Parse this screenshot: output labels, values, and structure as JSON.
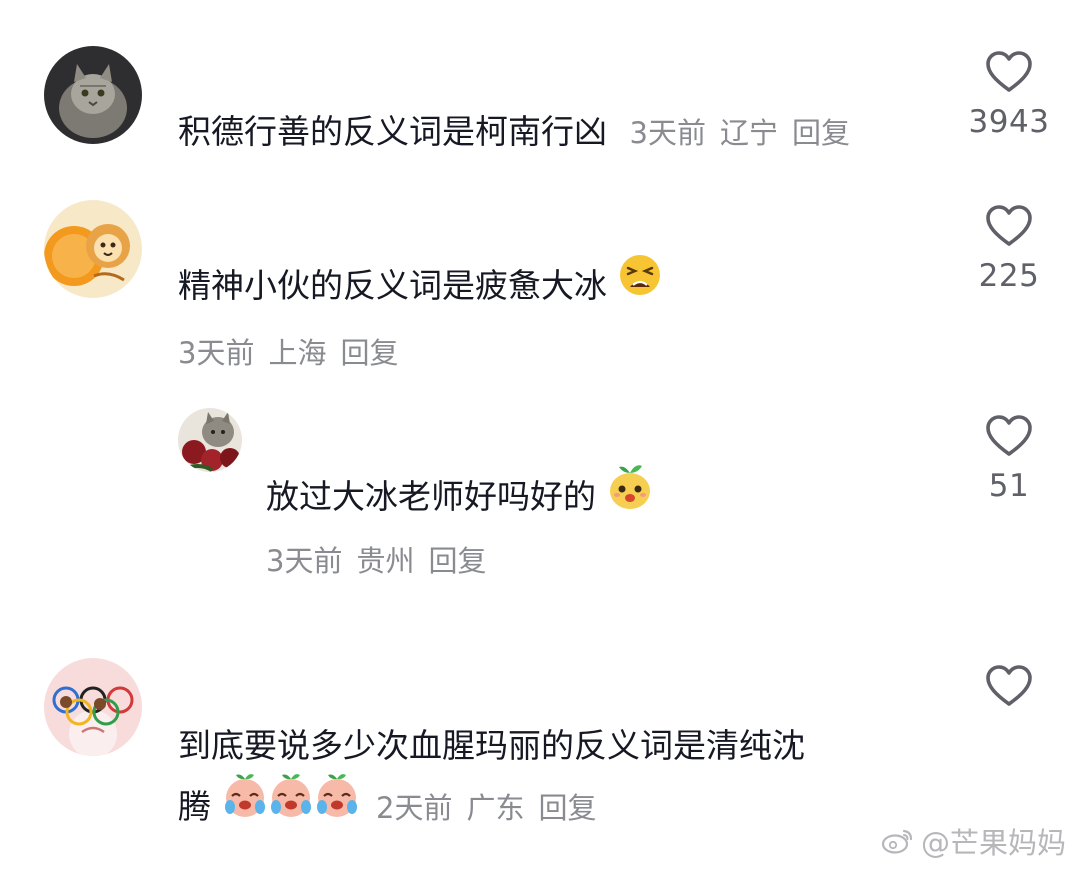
{
  "comments": [
    {
      "text": "积德行善的反义词是柯南行凶",
      "time": "3天前",
      "location": "辽宁",
      "reply_label": "回复",
      "likes": "3943",
      "avatar_icon": "cat-avatar-icon"
    },
    {
      "text": "精神小伙的反义词是疲惫大冰",
      "emoji_icon": "tired-face-emoji-icon",
      "time": "3天前",
      "location": "上海",
      "reply_label": "回复",
      "likes": "225",
      "avatar_icon": "lion-cartoon-avatar-icon"
    },
    {
      "text": "放过大冰老师好吗好的",
      "emoji_icon": "sprout-face-emoji-icon",
      "time": "3天前",
      "location": "贵州",
      "reply_label": "回复",
      "likes": "51",
      "avatar_icon": "cat-roses-avatar-icon"
    },
    {
      "text_line1": "到底要说多少次血腥玛丽的反义词是清纯沈",
      "text_line2": "腾",
      "emoji_icon": "crying-face-emoji-icon",
      "time": "2天前",
      "location": "广东",
      "reply_label": "回复",
      "likes": "",
      "avatar_icon": "olympic-rings-cartoon-avatar-icon"
    }
  ],
  "watermark": {
    "text": "@芒果妈妈",
    "icon": "weibo-logo-icon"
  },
  "colors": {
    "text": "#161823",
    "meta": "#8a8b91",
    "count": "#5f6068",
    "heart_stroke": "#5f6068",
    "watermark": "#b7b7bb"
  }
}
